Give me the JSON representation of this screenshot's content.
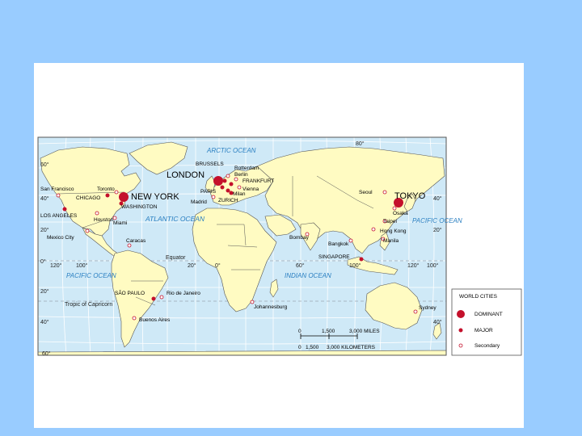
{
  "colors": {
    "background": "#99ccff",
    "ocean": "#cfe9f7",
    "land": "#fffbc2",
    "border": "#333333",
    "grid": "#ffffff",
    "city": "#c4102b",
    "ocean_label": "#2a7fc1"
  },
  "map": {
    "latitude_labels": [
      "80°",
      "60°",
      "40°",
      "40°",
      "20°",
      "20°",
      "0°",
      "20°",
      "40°",
      "40°",
      "60°"
    ],
    "longitude_labels": [
      "120°",
      "100°",
      "20°",
      "0°",
      "60°",
      "100°",
      "120°",
      "100°"
    ],
    "ocean_labels": {
      "arctic": "ARCTIC OCEAN",
      "atlantic": "ATLANTIC OCEAN",
      "pacific_east": "PACIFIC OCEAN",
      "pacific_west": "PACIFIC OCEAN",
      "indian": "INDIAN OCEAN"
    },
    "equator_label": "Equator",
    "tropic_label": "Tropic of Capricorn",
    "cities": {
      "dominant": [
        "LONDON",
        "NEW YORK",
        "TOKYO"
      ],
      "major": [
        "CHICAGO",
        "WASHINGTON",
        "LOS ANGELES",
        "BRUSSELS",
        "PARIS",
        "FRANKFURT",
        "ZURICH",
        "SÃO PAULO",
        "SINGAPORE",
        "Milan"
      ],
      "secondary": [
        "San Francisco",
        "Toronto",
        "Houston",
        "Miami",
        "Mexico City",
        "Caracas",
        "Rio de Janeiro",
        "Buenos Aires",
        "Rotterdam",
        "Berlin",
        "Vienna",
        "Madrid",
        "Johannesburg",
        "Bombay",
        "Bangkok",
        "Seoul",
        "Osaka",
        "Taipei",
        "Hong Kong",
        "Manila",
        "Sydney"
      ]
    },
    "scale": {
      "ticks": [
        "0",
        "1,500",
        "3,000 MILES"
      ],
      "km_ticks": [
        "0",
        "1,500",
        "3,000 KILOMETERS"
      ]
    }
  },
  "legend": {
    "title": "WORLD CITIES",
    "items": [
      "DOMINANT",
      "MAJOR",
      "Secondary"
    ]
  }
}
